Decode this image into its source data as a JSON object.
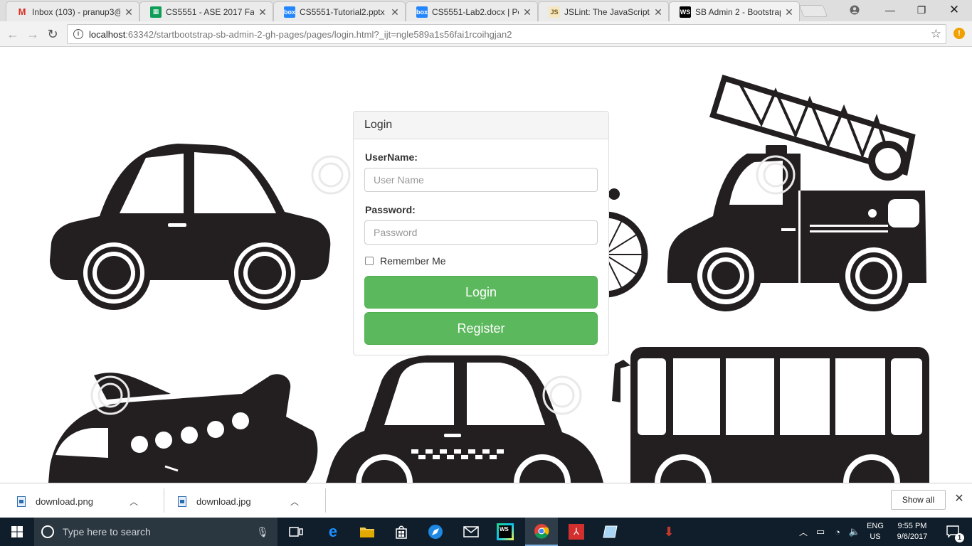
{
  "browser": {
    "tabs": [
      {
        "title": "Inbox (103) - pranup3@",
        "icon": "gmail-icon",
        "active": false
      },
      {
        "title": "CS5551 - ASE 2017 Fall",
        "icon": "sheets-icon",
        "active": false
      },
      {
        "title": "CS5551-Tutorial2.pptx |",
        "icon": "box-icon",
        "active": false
      },
      {
        "title": "CS5551-Lab2.docx | Po",
        "icon": "box-icon",
        "active": false
      },
      {
        "title": "JSLint: The JavaScript C",
        "icon": "jslint-icon",
        "active": false
      },
      {
        "title": "SB Admin 2 - Bootstrap",
        "icon": "webstorm-icon",
        "active": true
      }
    ],
    "address": {
      "host": "localhost",
      "rest": ":63342/startbootstrap-sb-admin-2-gh-pages/pages/login.html?_ijt=ngle589a1s56fai1rcoihgjan2"
    }
  },
  "login": {
    "heading": "Login",
    "username_label": "UserName:",
    "username_placeholder": "User Name",
    "password_label": "Password:",
    "password_placeholder": "Password",
    "remember_label": "Remember Me",
    "login_button": "Login",
    "register_button": "Register"
  },
  "downloads": {
    "items": [
      {
        "name": "download.png"
      },
      {
        "name": "download.jpg"
      }
    ],
    "show_all": "Show all"
  },
  "taskbar": {
    "search_placeholder": "Type here to search",
    "lang_top": "ENG",
    "lang_bottom": "US",
    "time": "9:55 PM",
    "date": "9/6/2017",
    "notification_count": "1"
  },
  "colors": {
    "button_green": "#5cb85c",
    "taskbar": "#101e2b",
    "vehicle": "#231f20"
  }
}
